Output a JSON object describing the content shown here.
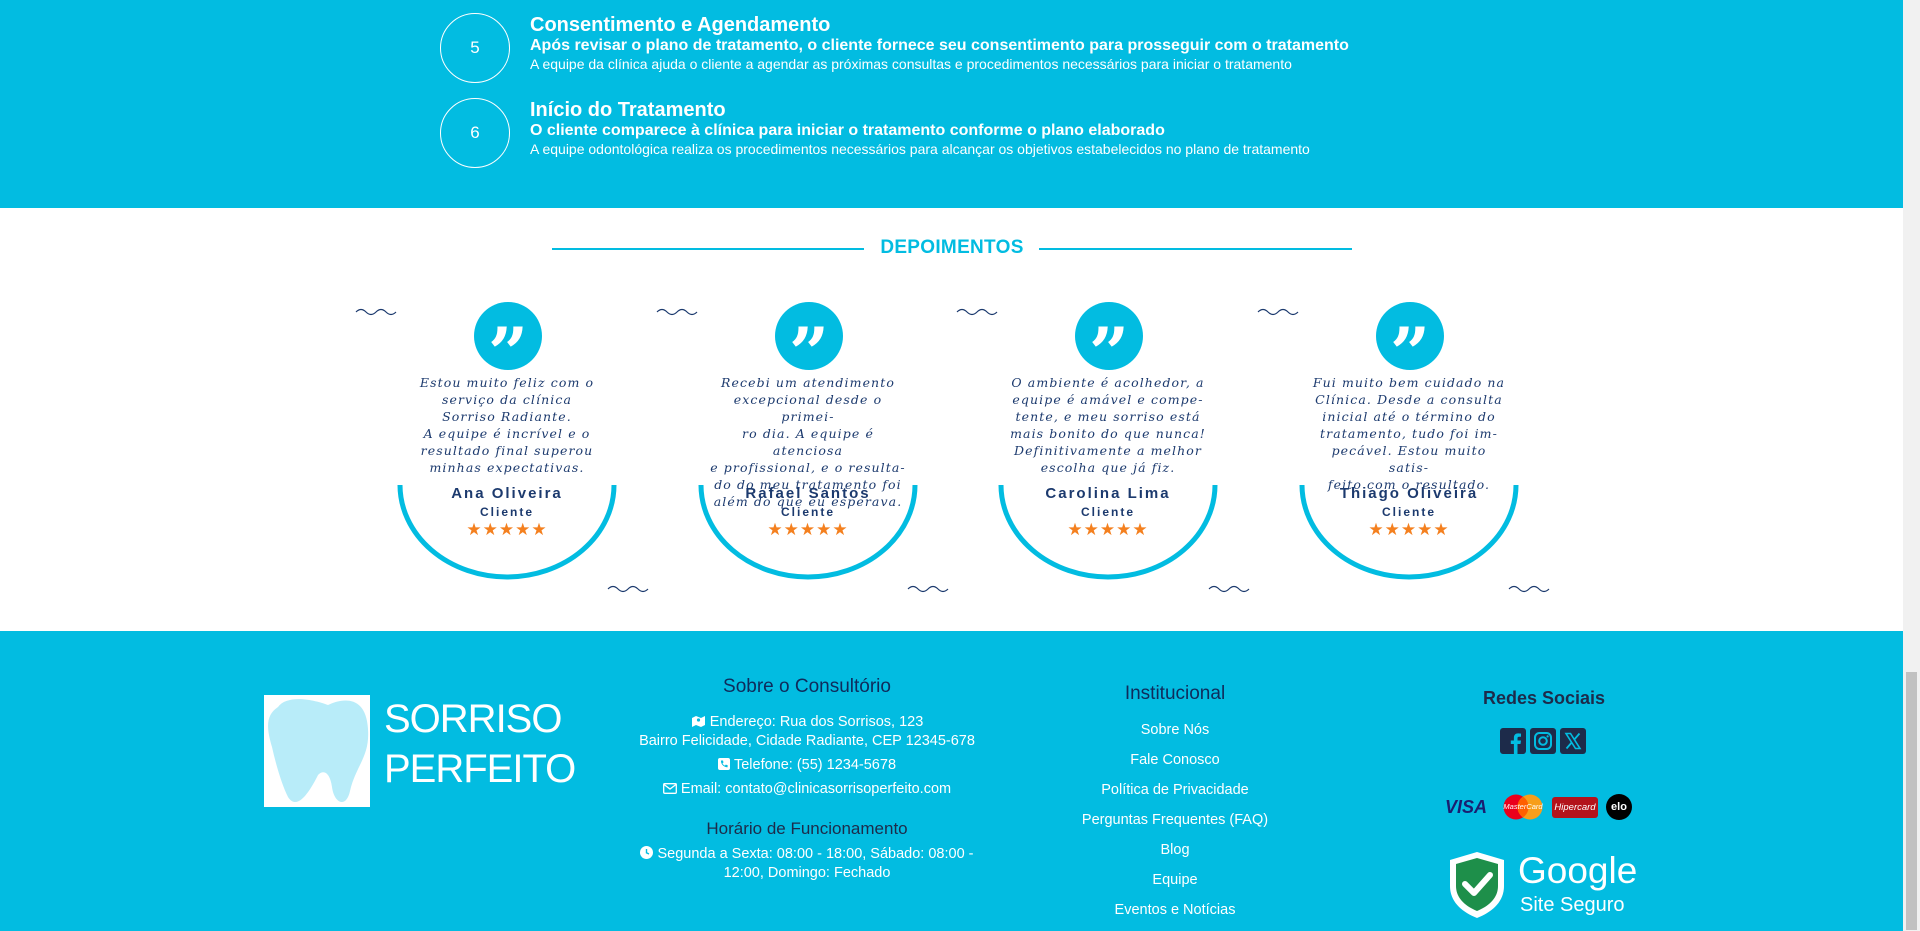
{
  "steps": [
    {
      "number": "5",
      "title": "Consentimento e Agendamento",
      "subtitle": "Após revisar o plano de tratamento, o cliente fornece seu consentimento para prosseguir com o tratamento",
      "description": "A equipe da clínica ajuda o cliente a agendar as próximas consultas e procedimentos necessários para iniciar o tratamento"
    },
    {
      "number": "6",
      "title": "Início do Tratamento",
      "subtitle": "O cliente comparece à clínica para iniciar o tratamento conforme o plano elaborado",
      "description": "A equipe odontológica realiza os procedimentos necessários para alcançar os objetivos estabelecidos no plano de tratamento"
    }
  ],
  "testimonials": {
    "title": "DEPOIMENTOS",
    "items": [
      {
        "text": "Estou muito feliz com o\nserviço da clínica\nSorriso Radiante.\nA equipe é incrível e o\nresultado final superou\nminhas expectativas.",
        "name": "Ana Oliveira",
        "role": "Cliente",
        "stars": "★★★★★"
      },
      {
        "text": "Recebi um atendimento\nexcepcional desde o primei-\nro dia. A equipe é atenciosa\ne profissional, e o resulta-\ndo do meu tratamento foi\nalém do que eu esperava.",
        "name": "Rafael Santos",
        "role": "Cliente",
        "stars": "★★★★★"
      },
      {
        "text": "O ambiente é acolhedor, a\nequipe é amável e compe-\ntente, e meu sorriso está\nmais bonito do que nunca!\nDefinitivamente a melhor\nescolha que já fiz.",
        "name": "Carolina Lima",
        "role": "Cliente",
        "stars": "★★★★★"
      },
      {
        "text": "Fui muito bem cuidado na\nClínica. Desde a consulta\ninicial até o término do\ntratamento, tudo foi im-\npecável. Estou muito satis-\nfeito com o resultado.",
        "name": "Thiago Oliveira",
        "role": "Cliente",
        "stars": "★★★★★"
      }
    ]
  },
  "footer": {
    "logo": {
      "line1": "SORRISO",
      "line2": "PERFEITO"
    },
    "about": {
      "title": "Sobre o Consultório",
      "address_line1": "Endereço: Rua dos Sorrisos, 123",
      "address_line2": "Bairro Felicidade, Cidade Radiante, CEP 12345-678",
      "phone": "Telefone: (55) 1234-5678",
      "email": "Email: contato@clinicasorrisoperfeito.com",
      "hours_title": "Horário de Funcionamento",
      "hours_line1": "Segunda a Sexta: 08:00 - 18:00, Sábado: 08:00 -",
      "hours_line2": "12:00, Domingo: Fechado"
    },
    "institutional": {
      "title": "Institucional",
      "links": [
        "Sobre Nós",
        "Fale Conosco",
        "Política de Privacidade",
        "Perguntas Frequentes (FAQ)",
        "Blog",
        "Equipe",
        "Eventos e Notícias"
      ]
    },
    "social": {
      "title": "Redes Sociais",
      "icons": [
        "facebook-icon",
        "instagram-icon",
        "x-twitter-icon"
      ]
    },
    "payments": {
      "visa": "VISA",
      "mastercard": "MasterCard",
      "hipercard": "Hipercard",
      "elo": "elo"
    },
    "secure_badge": {
      "brand": "Google",
      "label": "Site Seguro"
    }
  },
  "colors": {
    "primary": "#02bce1",
    "dark_text": "#1c3a6e",
    "star": "#f4801f",
    "footer_title": "#0f2b5b"
  }
}
